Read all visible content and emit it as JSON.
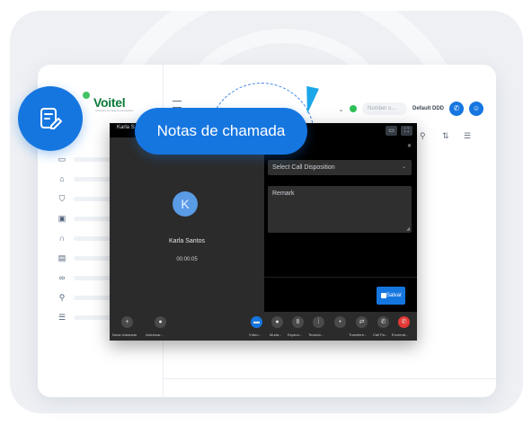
{
  "brand": {
    "name": "Voitel",
    "tagline": "soluções em Telecomunicações"
  },
  "topbar": {
    "number_placeholder": "Number o...",
    "ddd_label": "Default DDD"
  },
  "callout": {
    "label": "Notas de chamada"
  },
  "call": {
    "title": "Karla S",
    "caller_name": "Karla Santos",
    "initial": "K",
    "timer": "00:00:05",
    "disposition_placeholder": "Select Call Disposition",
    "remark_placeholder": "Remark",
    "save_label": "Salvar",
    "controls": [
      {
        "icon": "add-call-icon",
        "label": "Nova chamada"
      },
      {
        "icon": "user-icon",
        "label": "Adicionar..."
      },
      {
        "icon": "video-icon",
        "label": "Vídeo..."
      },
      {
        "icon": "mute-icon",
        "label": "Muda..."
      },
      {
        "icon": "hold-icon",
        "label": "Espera..."
      },
      {
        "icon": "keypad-icon",
        "label": "Teclado..."
      },
      {
        "icon": "record-icon",
        "label": ""
      },
      {
        "icon": "transfer-icon",
        "label": "Transfere..."
      },
      {
        "icon": "park-icon",
        "label": "Call Pa..."
      },
      {
        "icon": "hangup-icon",
        "label": "Encerrar..."
      }
    ]
  },
  "colors": {
    "accent": "#1676e0",
    "hangup": "#e53935",
    "online": "#2fbf58",
    "brand_green": "#0c7a3a"
  }
}
